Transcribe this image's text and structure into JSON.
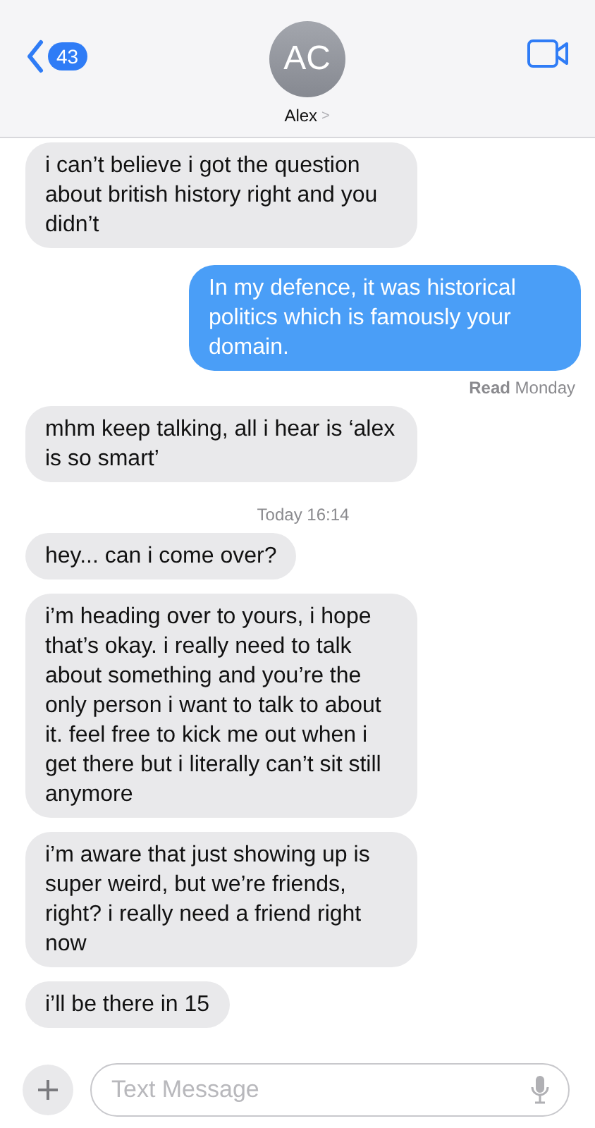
{
  "header": {
    "back_count": "43",
    "avatar_initials": "AC",
    "contact_name": "Alex",
    "chevron": ">"
  },
  "messages": [
    {
      "kind": "received",
      "text": "i can’t believe i got the question about british history right and you didn’t"
    },
    {
      "kind": "sent",
      "text": "In my defence, it was historical politics which is famously your domain."
    },
    {
      "kind": "receipt",
      "text": "**Read** Monday"
    },
    {
      "kind": "received",
      "text": "mhm keep talking, all i hear is ‘alex is so smart’"
    },
    {
      "kind": "timestamp",
      "text": "Today 16:14"
    },
    {
      "kind": "received",
      "text": "hey... can i come over?"
    },
    {
      "kind": "received",
      "text": "i’m heading over to yours, i hope that’s okay. i really need to talk about something and you’re the only person i want to talk to about it. feel free to kick me out when i get there but i literally can’t sit still anymore"
    },
    {
      "kind": "received",
      "text": "i’m aware that just showing up is super weird, but we’re friends, right? i really need a friend right now"
    },
    {
      "kind": "received",
      "text": "i’ll be there in 15"
    }
  ],
  "composer": {
    "placeholder": "Text Message"
  }
}
